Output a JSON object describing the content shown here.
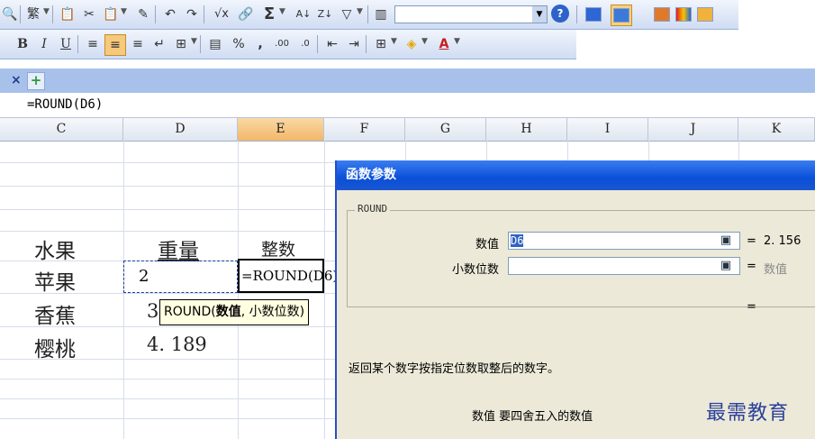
{
  "formula_bar": {
    "value": "=ROUND(D6)"
  },
  "columns": [
    "C",
    "D",
    "E",
    "F",
    "G",
    "H",
    "I",
    "J",
    "K"
  ],
  "cells": {
    "header_fruit": "水果",
    "header_weight": "重量",
    "header_integer": "整数",
    "row1_fruit": "苹果",
    "row1_weight": "2",
    "row1_formula": "=ROUND(D6)",
    "row2_fruit": "香蕉",
    "row2_weight": "3",
    "row3_fruit": "樱桃",
    "row3_weight": "4. 189"
  },
  "tooltip": {
    "func": "ROUND",
    "arg1": "数值",
    "rest": "小数位数)",
    "open": "(",
    "comma": ","
  },
  "dialog": {
    "title": "函数参数",
    "group_label": "ROUND",
    "arg1_label": "数值",
    "arg1_value": "D6",
    "arg1_result": "2. 156",
    "arg2_label": "小数位数",
    "arg2_value": "",
    "arg2_result": "数值",
    "equals": "=",
    "result_equals": "=",
    "description": "返回某个数字按指定位数取整后的数字。",
    "arg_description": "数值  要四舍五入的数值"
  },
  "toolbar": {
    "font_size_value": "",
    "sum_symbol": "Σ",
    "percent_symbol": "%",
    "comma_symbol": ","
  },
  "tabs": {
    "close": "×",
    "add": "+"
  },
  "watermark": "最需教育",
  "colors": {
    "title_bar": "#0a4fd9",
    "selected_col": "#f2b768",
    "tooltip_bg": "#ffffe1"
  }
}
